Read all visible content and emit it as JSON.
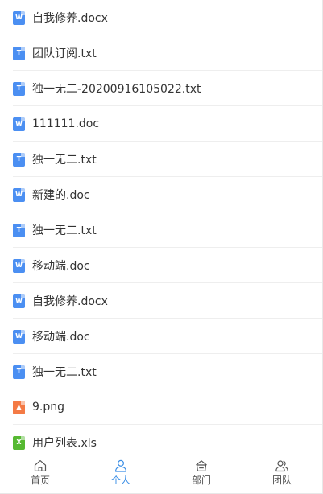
{
  "files": [
    {
      "name": "自我修养.docx",
      "type": "word",
      "glyph": "W"
    },
    {
      "name": "团队订阅.txt",
      "type": "txt",
      "glyph": "T"
    },
    {
      "name": "独一无二-20200916105022.txt",
      "type": "txt",
      "glyph": "T"
    },
    {
      "name": "111111.doc",
      "type": "word",
      "glyph": "W"
    },
    {
      "name": "独一无二.txt",
      "type": "txt",
      "glyph": "T"
    },
    {
      "name": "新建的.doc",
      "type": "word",
      "glyph": "W"
    },
    {
      "name": "独一无二.txt",
      "type": "txt",
      "glyph": "T"
    },
    {
      "name": "移动端.doc",
      "type": "word",
      "glyph": "W"
    },
    {
      "name": "自我修养.docx",
      "type": "word",
      "glyph": "W"
    },
    {
      "name": "移动端.doc",
      "type": "word",
      "glyph": "W"
    },
    {
      "name": "独一无二.txt",
      "type": "txt",
      "glyph": "T"
    },
    {
      "name": "9.png",
      "type": "img",
      "glyph": "▲"
    },
    {
      "name": "用户列表.xls",
      "type": "xls",
      "glyph": "X"
    }
  ],
  "tabbar": {
    "tabs": [
      {
        "label": "首页",
        "icon": "home-icon",
        "active": false
      },
      {
        "label": "个人",
        "icon": "person-icon",
        "active": true
      },
      {
        "label": "部门",
        "icon": "department-icon",
        "active": false
      },
      {
        "label": "团队",
        "icon": "team-icon",
        "active": false
      }
    ]
  },
  "colors": {
    "accent": "#3a8ee6",
    "word": "#4b8ff2",
    "txt": "#4b8ff2",
    "image": "#f47a45",
    "excel": "#56b932"
  }
}
